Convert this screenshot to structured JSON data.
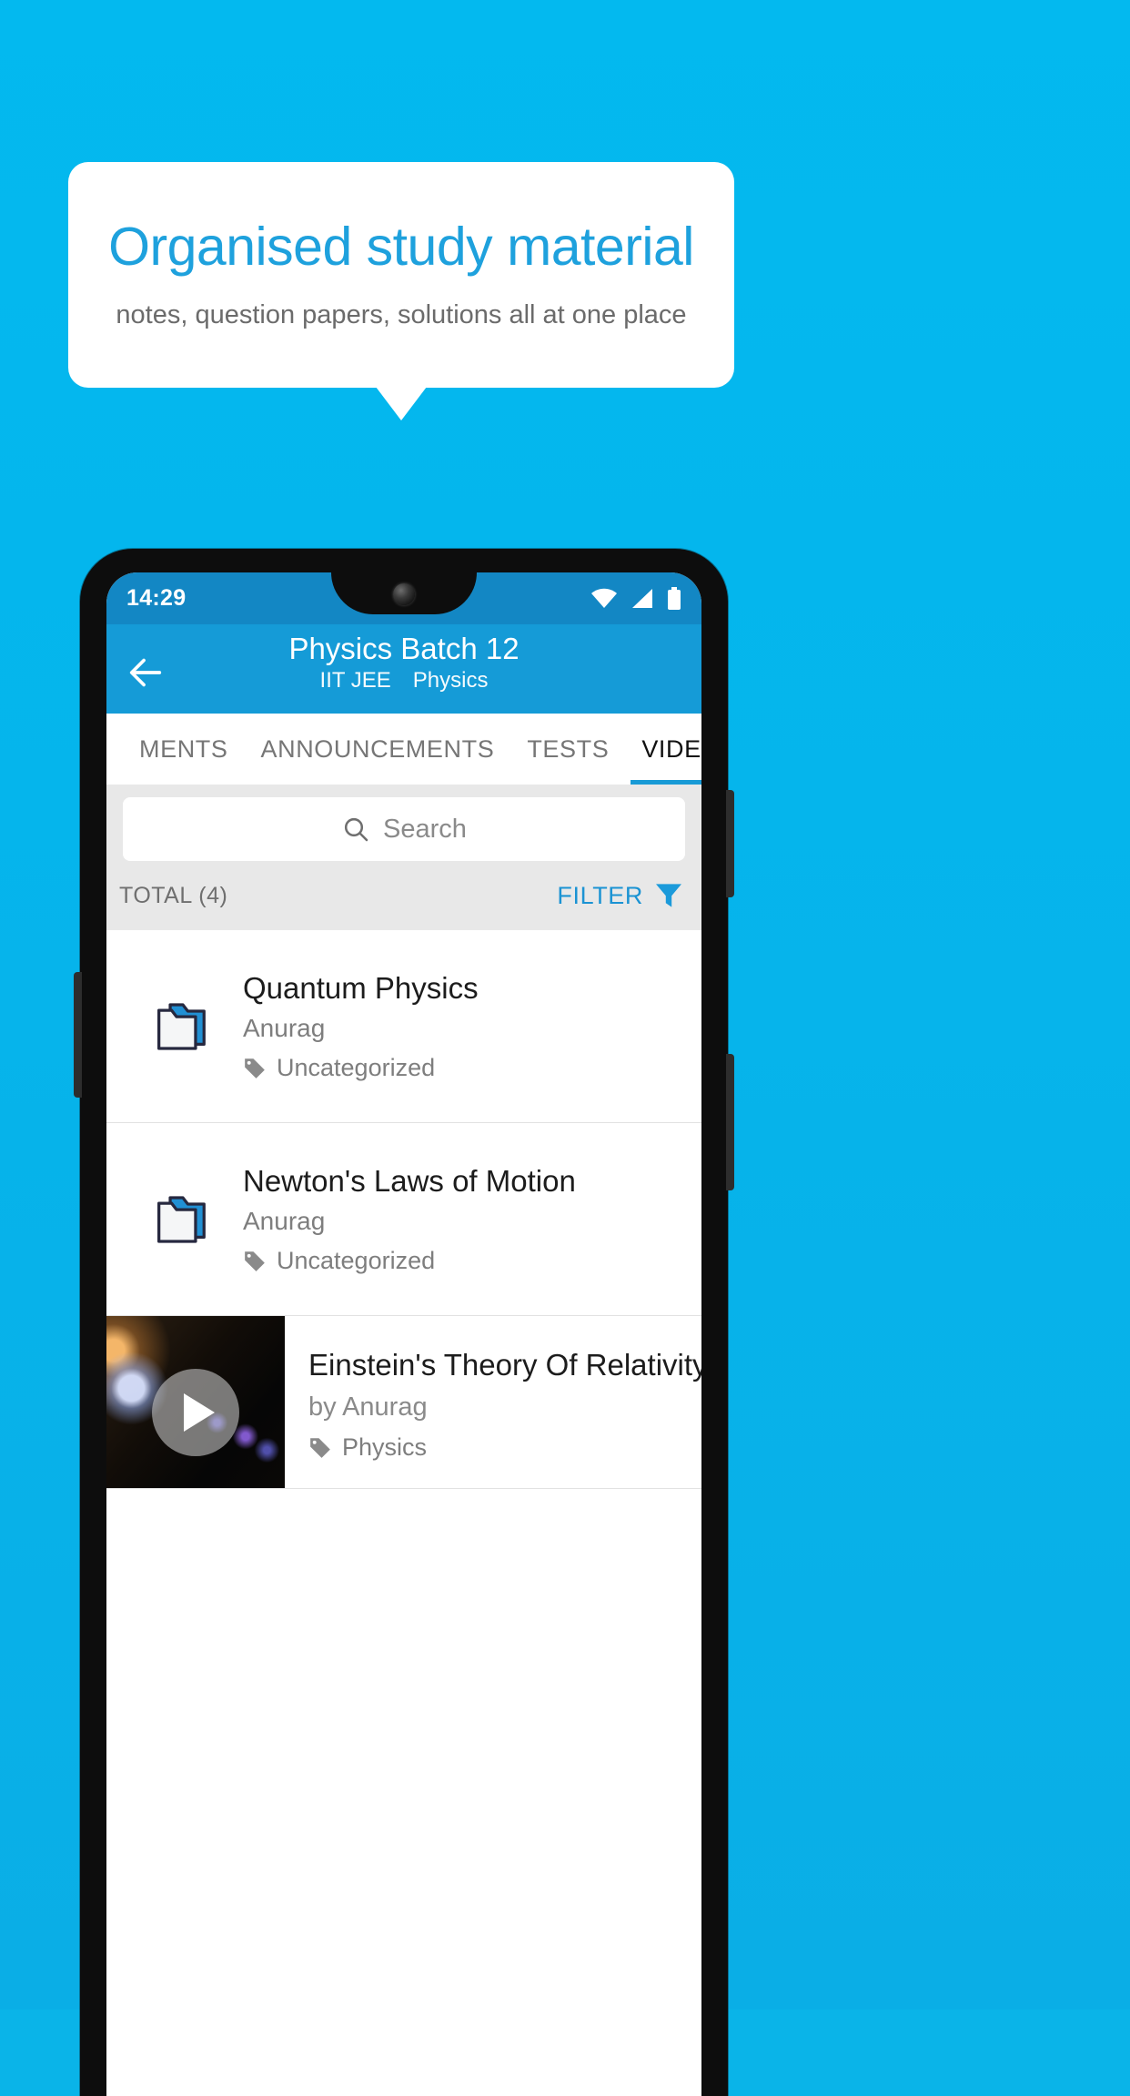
{
  "promo": {
    "title": "Organised study material",
    "subtitle": "notes, question papers, solutions all at one place",
    "title_color": "#1ea1dd",
    "background_color": "#05b5ec"
  },
  "phone": {
    "statusbar": {
      "time": "14:29",
      "icons": [
        "wifi-icon",
        "signal-icon",
        "battery-icon"
      ],
      "background_color": "#1387c4"
    },
    "appbar": {
      "back_icon": "back-arrow-icon",
      "title": "Physics Batch 12",
      "subtitle_items": [
        "IIT JEE",
        "Physics"
      ],
      "background_color": "#159bd7"
    },
    "tabs": [
      {
        "label": "MENTS",
        "active": false
      },
      {
        "label": "ANNOUNCEMENTS",
        "active": false
      },
      {
        "label": "TESTS",
        "active": false
      },
      {
        "label": "VIDEOS",
        "active": true
      }
    ],
    "search": {
      "placeholder": "Search",
      "value": "",
      "icon": "search-icon"
    },
    "meta": {
      "total_label": "TOTAL (4)",
      "filter_label": "FILTER",
      "filter_icon": "filter-funnel-icon",
      "filter_color": "#1b93d3"
    },
    "list": [
      {
        "type": "folder",
        "icon": "folder-icon",
        "title": "Quantum Physics",
        "author": "Anurag",
        "tag_icon": "tag-icon",
        "tag": "Uncategorized"
      },
      {
        "type": "folder",
        "icon": "folder-icon",
        "title": "Newton's Laws of Motion",
        "author": "Anurag",
        "tag_icon": "tag-icon",
        "tag": "Uncategorized"
      },
      {
        "type": "video",
        "icon": "video-thumbnail",
        "play_icon": "play-icon",
        "title": "Einstein's Theory Of Relativity",
        "author": "by Anurag",
        "tag_icon": "tag-icon",
        "tag": "Physics"
      }
    ]
  }
}
